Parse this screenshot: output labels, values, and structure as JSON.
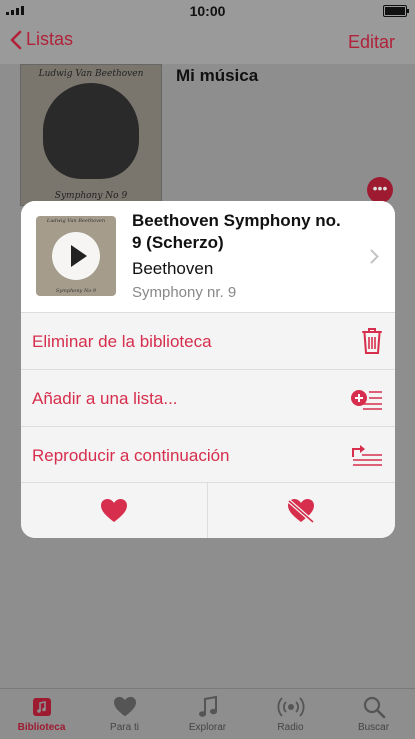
{
  "status_bar": {
    "time": "10:00"
  },
  "nav": {
    "back_label": "Listas",
    "edit_label": "Editar"
  },
  "playlist": {
    "title": "Mi música",
    "cover_top_text": "Ludwig Van Beethoven",
    "cover_bottom_text": "Symphony No 9",
    "more_label": "•••"
  },
  "sheet": {
    "song_title": "Beethoven Symphony no. 9 (Scherzo)",
    "artist": "Beethoven",
    "album": "Symphony nr. 9",
    "thumb_top_text": "Ludwig Van Beethoven",
    "thumb_bottom_text": "Symphony No 9",
    "actions": [
      {
        "label": "Eliminar de la biblioteca",
        "icon": "trash-icon"
      },
      {
        "label": "Añadir a una lista...",
        "icon": "add-to-list-icon"
      },
      {
        "label": "Reproducir a continuación",
        "icon": "play-next-icon"
      }
    ],
    "bottom_actions": [
      {
        "icon": "heart-icon"
      },
      {
        "icon": "heart-broken-icon"
      }
    ]
  },
  "tabs": [
    {
      "label": "Biblioteca",
      "icon": "library-icon",
      "active": true
    },
    {
      "label": "Para ti",
      "icon": "heart-icon",
      "active": false
    },
    {
      "label": "Explorar",
      "icon": "music-note-icon",
      "active": false
    },
    {
      "label": "Radio",
      "icon": "radio-icon",
      "active": false
    },
    {
      "label": "Buscar",
      "icon": "search-icon",
      "active": false
    }
  ],
  "colors": {
    "accent": "#d62e4c",
    "dim_accent": "#9e1a30"
  }
}
